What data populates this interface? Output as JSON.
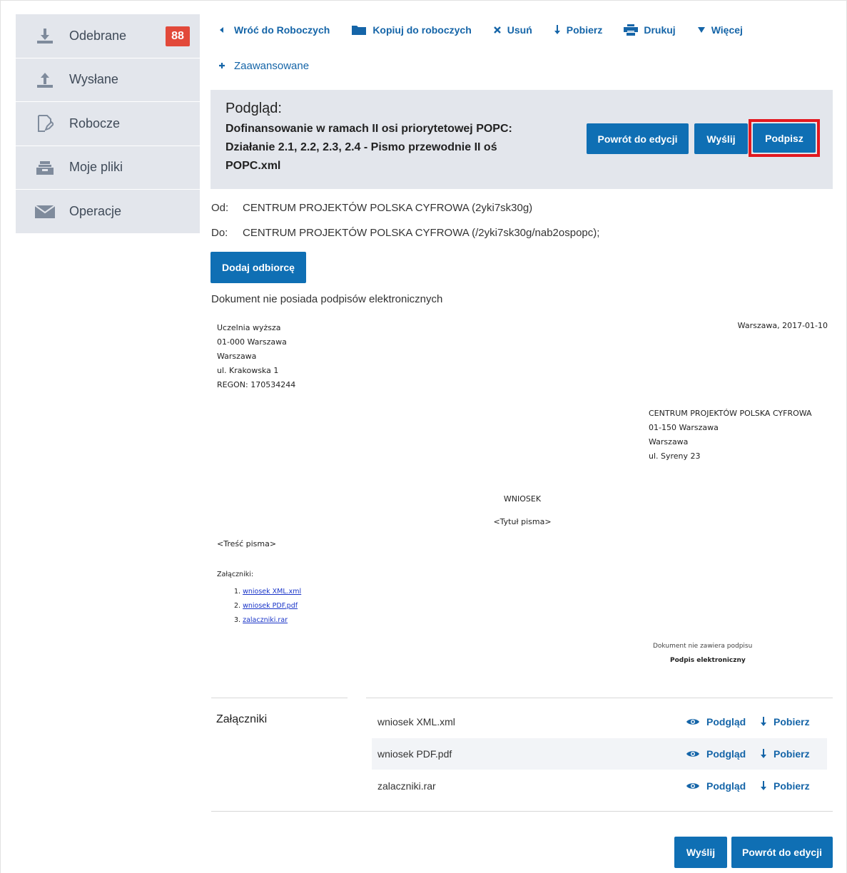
{
  "sidebar": {
    "items": [
      {
        "label": "Odebrane",
        "icon": "inbox-download-icon",
        "badge": "88"
      },
      {
        "label": "Wysłane",
        "icon": "outbox-upload-icon"
      },
      {
        "label": "Robocze",
        "icon": "draft-edit-icon"
      },
      {
        "label": "Moje pliki",
        "icon": "folder-tray-icon"
      },
      {
        "label": "Operacje",
        "icon": "envelope-icon"
      }
    ]
  },
  "toolbar": {
    "back": "Wróć do Roboczych",
    "copy": "Kopiuj do roboczych",
    "delete": "Usuń",
    "download": "Pobierz",
    "print": "Drukuj",
    "more": "Więcej",
    "advanced": "Zaawansowane"
  },
  "preview": {
    "title": "Podgląd:",
    "subject": "Dofinansowanie w ramach II osi priorytetowej POPC: Działanie 2.1, 2.2, 2.3, 2.4 - Pismo przewodnie II oś POPC.xml",
    "back_button": "Powrót do edycji",
    "send_button": "Wyślij",
    "sign_button": "Podpisz",
    "highlight_color": "#e3181f"
  },
  "message": {
    "from_label": "Od:",
    "from_value": "CENTRUM PROJEKTÓW POLSKA CYFROWA (2yki7sk30g)",
    "to_label": "Do:",
    "to_value": "CENTRUM PROJEKTÓW POLSKA CYFROWA (/2yki7sk30g/nab2ospopc);",
    "add_recipient_button": "Dodaj odbiorcę",
    "no_signatures": "Dokument nie posiada podpisów elektronicznych"
  },
  "document": {
    "sender": {
      "line1": "Uczelnia wyższa",
      "line2": "01-000 Warszawa",
      "line3": "Warszawa",
      "line4": "ul. Krakowska 1",
      "line5": "REGON: 170534244"
    },
    "date": "Warszawa, 2017-01-10",
    "recipient": {
      "line1": "CENTRUM PROJEKTÓW POLSKA CYFROWA",
      "line2": "01-150 Warszawa",
      "line3": "Warszawa",
      "line4": "ul. Syreny 23"
    },
    "kind": "WNIOSEK",
    "letter_title": "<Tytuł pisma>",
    "body": "<Treść pisma>",
    "attachments_label": "Załączniki:",
    "attachments": [
      {
        "num": "1.",
        "name": "wniosek XML.xml"
      },
      {
        "num": "2.",
        "name": "wniosek PDF.pdf"
      },
      {
        "num": "3.",
        "name": "zalaczniki.rar"
      }
    ],
    "signature_note": "Dokument nie zawiera podpisu",
    "signature_label": "Podpis elektroniczny"
  },
  "attachments_section": {
    "heading": "Załączniki",
    "view_label": "Podgląd",
    "download_label": "Pobierz",
    "files": [
      "wniosek XML.xml",
      "wniosek PDF.pdf",
      "zalaczniki.rar"
    ]
  },
  "footer": {
    "send_button": "Wyślij",
    "back_button": "Powrót do edycji"
  },
  "colors": {
    "primary": "#0f6fb4",
    "link": "#1565a8",
    "badge": "#e2493a",
    "sidebar_bg": "#e3e6ec"
  }
}
